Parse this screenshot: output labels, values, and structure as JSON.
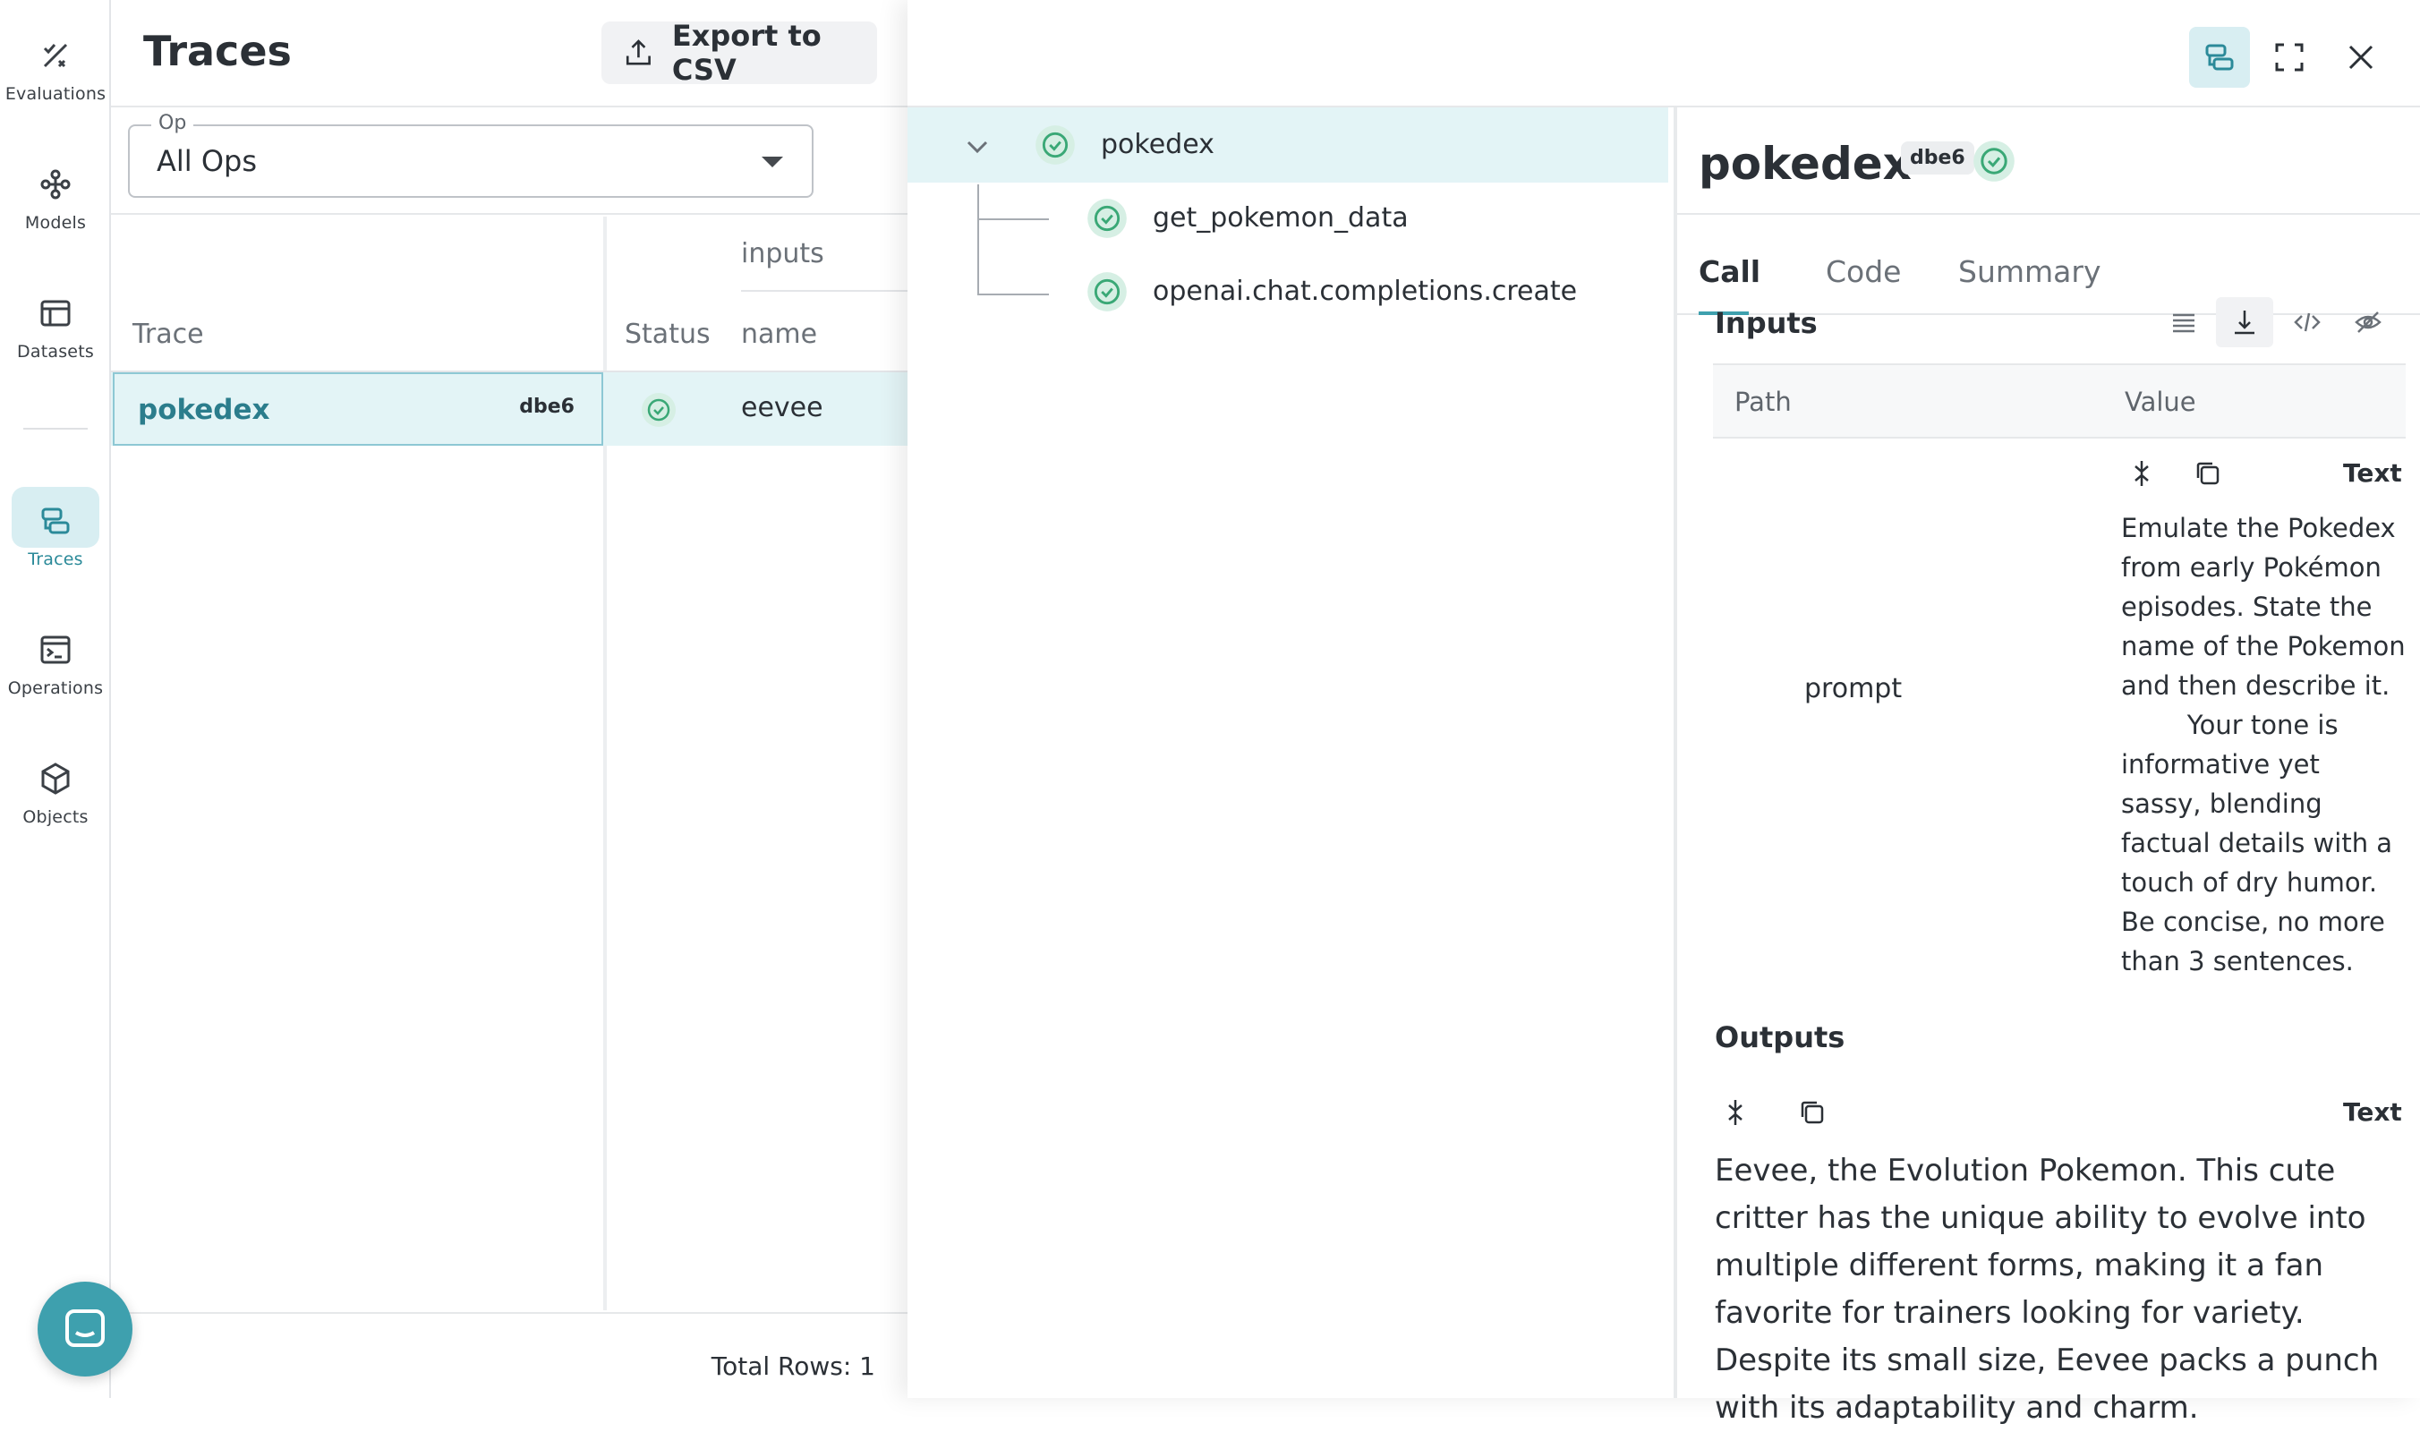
{
  "nav": {
    "items": [
      {
        "label": "Evaluations",
        "icon": "evaluations-icon"
      },
      {
        "label": "Models",
        "icon": "models-icon"
      },
      {
        "label": "Datasets",
        "icon": "datasets-icon"
      },
      {
        "label": "Traces",
        "icon": "traces-icon",
        "active": true
      },
      {
        "label": "Operations",
        "icon": "operations-icon"
      },
      {
        "label": "Objects",
        "icon": "objects-icon"
      }
    ]
  },
  "traces": {
    "title": "Traces",
    "export_label": "Export to CSV",
    "op_filter": {
      "legend": "Op",
      "value": "All Ops"
    },
    "columns": {
      "trace": "Trace",
      "status": "Status",
      "inputs_group": "inputs",
      "input_name": "name"
    },
    "rows": [
      {
        "trace": "pokedex",
        "id": "dbe6",
        "status": "success",
        "input_name": "eevee"
      }
    ],
    "total_rows_label": "Total Rows: 1"
  },
  "drawer": {
    "tree": [
      {
        "label": "pokedex",
        "status": "success",
        "selected": true
      },
      {
        "label": "get_pokemon_data",
        "status": "success"
      },
      {
        "label": "openai.chat.completions.create",
        "status": "success"
      }
    ],
    "details": {
      "title": "pokedex",
      "id": "dbe6",
      "tabs": [
        "Call",
        "Code",
        "Summary"
      ],
      "active_tab": "Call",
      "inputs_heading": "Inputs",
      "table_path_header": "Path",
      "table_value_header": "Value",
      "format_label": "Text",
      "inputs": [
        {
          "path": "prompt",
          "value": "Emulate the Pokedex from early Pokémon episodes. State the name of the Pokemon and then describe it.\n        Your tone is informative yet sassy, blending factual details with a touch of dry humor. Be concise, no more than 3 sentences."
        }
      ],
      "outputs_heading": "Outputs",
      "output_value": "Eevee, the Evolution Pokemon. This cute critter has the unique ability to evolve into multiple different forms, making it a fan favorite for trainers looking for variety. Despite its small size, Eevee packs a punch with its adaptability and charm."
    }
  },
  "colors": {
    "accent": "#3ea0ae",
    "selected_bg": "#e3f4f6",
    "success": "#3aa876"
  }
}
